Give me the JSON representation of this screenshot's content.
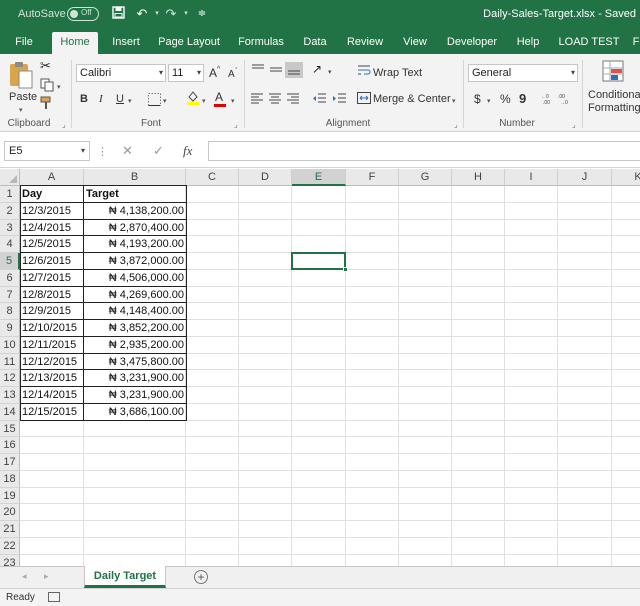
{
  "titlebar": {
    "autosave_label": "AutoSave",
    "autosave_state": "Off",
    "document_title": "Daily-Sales-Target.xlsx  -  Saved"
  },
  "tabs": [
    {
      "label": "File"
    },
    {
      "label": "Home"
    },
    {
      "label": "Insert"
    },
    {
      "label": "Page Layout"
    },
    {
      "label": "Formulas"
    },
    {
      "label": "Data"
    },
    {
      "label": "Review"
    },
    {
      "label": "View"
    },
    {
      "label": "Developer"
    },
    {
      "label": "Help"
    },
    {
      "label": "LOAD TEST"
    },
    {
      "label": "F"
    }
  ],
  "active_tab": "Home",
  "ribbon": {
    "clipboard": {
      "paste_label": "Paste",
      "group_label": "Clipboard"
    },
    "font": {
      "family": "Calibri",
      "size": "11",
      "group_label": "Font",
      "bold": "B",
      "italic": "I",
      "underline": "U",
      "grow": "A",
      "shrink": "A",
      "font_color_letter": "A"
    },
    "alignment": {
      "wrap_label": "Wrap Text",
      "merge_label": "Merge & Center",
      "group_label": "Alignment"
    },
    "number": {
      "format": "General",
      "currency": "$",
      "percent": "%",
      "comma": "9",
      "group_label": "Number"
    },
    "styles": {
      "conditional_line1": "Conditional",
      "conditional_line2": "Formatting"
    },
    "colors": {
      "accent": "#217346",
      "font_color": "#e00000",
      "highlight": "#ffff00"
    }
  },
  "formula_bar": {
    "name_box": "E5",
    "fx_label": "fx",
    "cancel_symbol": "✕",
    "enter_symbol": "✓",
    "content": ""
  },
  "sheet": {
    "columns": [
      "A",
      "B",
      "C",
      "D",
      "E",
      "F",
      "G",
      "H",
      "I",
      "J",
      "K"
    ],
    "rows": [
      "1",
      "2",
      "3",
      "4",
      "5",
      "6",
      "7",
      "8",
      "9",
      "10",
      "11",
      "12",
      "13",
      "14",
      "15",
      "16",
      "17",
      "18",
      "19",
      "20",
      "21",
      "22",
      "23"
    ],
    "selected_cell": "E5",
    "header": {
      "day": "Day",
      "target": "Target"
    },
    "data": [
      {
        "day": "12/3/2015",
        "target": "₦ 4,138,200.00"
      },
      {
        "day": "12/4/2015",
        "target": "₦ 2,870,400.00"
      },
      {
        "day": "12/5/2015",
        "target": "₦ 4,193,200.00"
      },
      {
        "day": "12/6/2015",
        "target": "₦ 3,872,000.00"
      },
      {
        "day": "12/7/2015",
        "target": "₦ 4,506,000.00"
      },
      {
        "day": "12/8/2015",
        "target": "₦ 4,269,600.00"
      },
      {
        "day": "12/9/2015",
        "target": "₦ 4,148,400.00"
      },
      {
        "day": "12/10/2015",
        "target": "₦ 3,852,200.00"
      },
      {
        "day": "12/11/2015",
        "target": "₦ 2,935,200.00"
      },
      {
        "day": "12/12/2015",
        "target": "₦ 3,475,800.00"
      },
      {
        "day": "12/13/2015",
        "target": "₦ 3,231,900.00"
      },
      {
        "day": "12/14/2015",
        "target": "₦ 3,231,900.00"
      },
      {
        "day": "12/15/2015",
        "target": "₦ 3,686,100.00"
      }
    ]
  },
  "sheet_tabs": {
    "active": "Daily Target",
    "add_symbol": "+"
  },
  "status": {
    "text": "Ready"
  }
}
